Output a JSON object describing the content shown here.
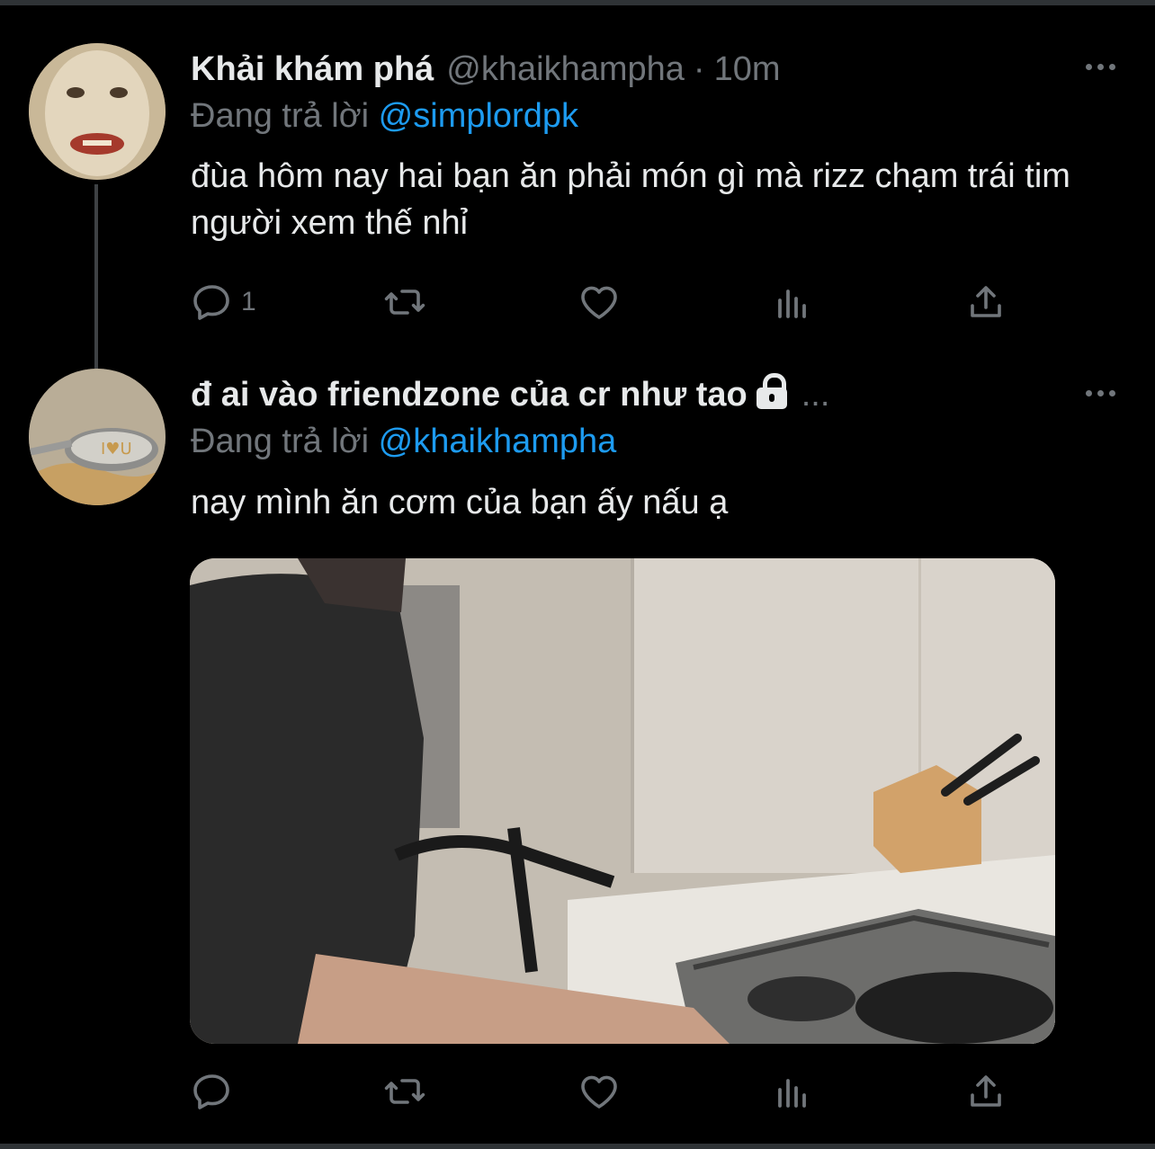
{
  "tweets": [
    {
      "name": "Khải khám phá",
      "handle": "@khaikhampha",
      "separator": "·",
      "time": "10m",
      "replying_prefix": "Đang trả lời",
      "replying_to": "@simplordpk",
      "text": "đùa hôm nay hai bạn ăn phải món gì mà rizz chạm trái tim người xem thế nhỉ",
      "reply_count": "1"
    },
    {
      "name": "đ ai vào friendzone của cr như tao",
      "name_suffix": "...",
      "replying_prefix": "Đang trả lời",
      "replying_to": "@khaikhampha",
      "text": "nay mình ăn cơm của bạn ấy nấu ạ"
    }
  ],
  "colors": {
    "background": "#000000",
    "text": "#e7e9ea",
    "muted": "#71767b",
    "link": "#1d9bf0"
  },
  "icons": [
    "reply-icon",
    "retweet-icon",
    "like-icon",
    "analytics-icon",
    "share-icon",
    "more-icon",
    "lock-icon"
  ]
}
